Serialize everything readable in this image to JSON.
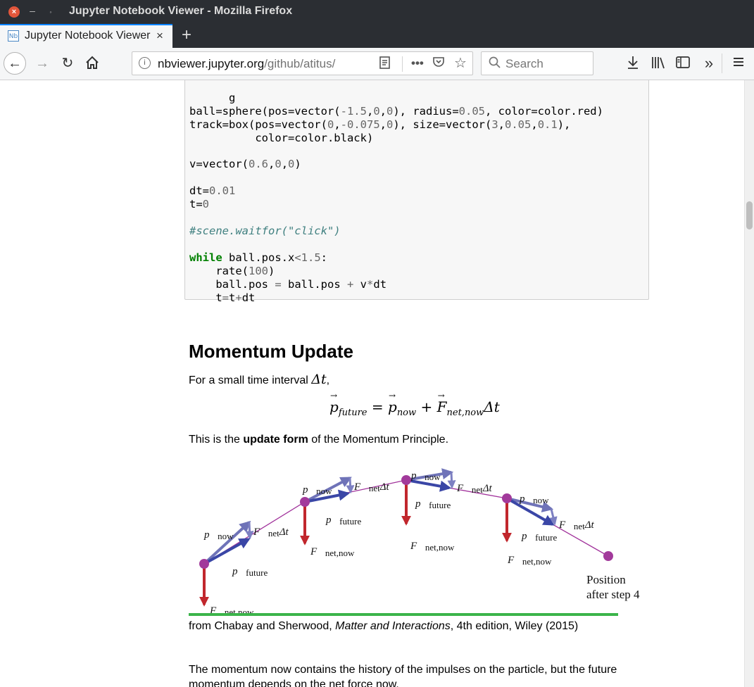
{
  "window": {
    "title": "Jupyter Notebook Viewer - Mozilla Firefox"
  },
  "tab": {
    "favicon_text": "Nb",
    "title": "Jupyter Notebook Viewer",
    "close_glyph": "×"
  },
  "toolbar": {
    "url_host": "nbviewer.jupyter.org",
    "url_path": "/github/atitus/",
    "search_placeholder": "Search"
  },
  "code": {
    "lines": [
      "ball=sphere(pos=vector(-1.5,0,0), radius=0.05, color=color.red)",
      "track=box(pos=vector(0,-0.075,0), size=vector(3,0.05,0.1),",
      "          color=color.black)",
      "v=vector(0.6,0,0)",
      "dt=0.01",
      "t=0",
      "#scene.waitfor(\"click\")",
      "while ball.pos.x<1.5:",
      "    rate(100)",
      "    ball.pos = ball.pos + v*dt",
      "    t=t+dt"
    ]
  },
  "section": {
    "heading": "Momentum Update",
    "intro": "For a small time interval",
    "intro_math": "Δt",
    "intro_tail": ",",
    "equation": {
      "p_future_sub": "future",
      "p_now_sub": "now",
      "f_sub": "net,now",
      "dt": "Δt"
    },
    "update_pre": "This is the ",
    "update_bold": "update form",
    "update_post": " of the Momentum Principle.",
    "caption_pre": "from Chabay and Sherwood, ",
    "caption_italic": "Matter and Interactions",
    "caption_post": ", 4th edition, Wiley (2015)",
    "bottom_line1": "The momentum now contains the history of the impulses on the particle, but the future",
    "bottom_line2": "momentum depends on the net force now."
  },
  "figure": {
    "labels": {
      "p_now": "now",
      "p_future": "future",
      "f_net": "net",
      "f_net_now": "net,now",
      "dt": "Δt",
      "position_line1": "Position",
      "position_line2": "after step 4"
    },
    "colors": {
      "p_now": "#6f73b8",
      "p_future": "#3a46a6",
      "f_net": "#7d80c2",
      "force": "#c1272d",
      "path": "#a0309a",
      "ball": "#a23a9b",
      "rule": "#3bb44a"
    }
  }
}
